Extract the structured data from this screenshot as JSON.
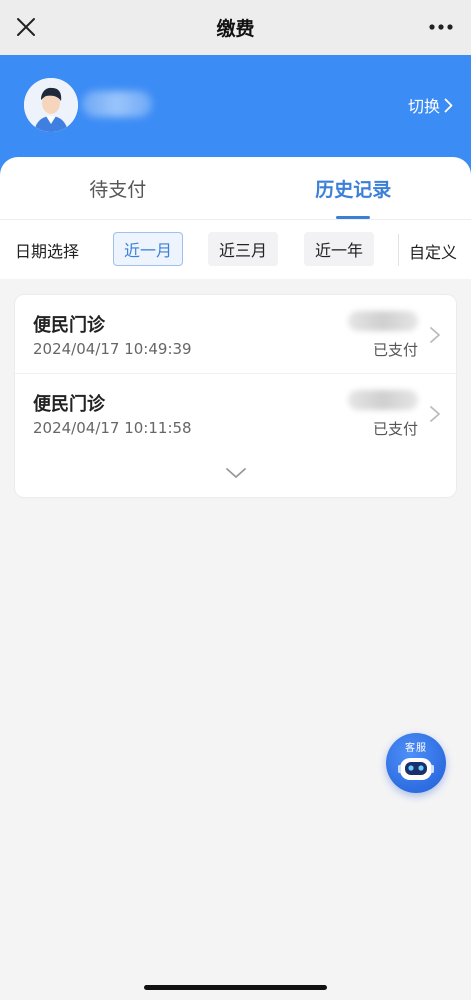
{
  "navbar": {
    "title": "缴费"
  },
  "header": {
    "switch_label": "切换"
  },
  "tabs": [
    {
      "label": "待支付",
      "active": false
    },
    {
      "label": "历史记录",
      "active": true
    }
  ],
  "date_filter": {
    "label": "日期选择",
    "options": [
      "近一月",
      "近三月",
      "近一年"
    ],
    "selected": "近一月",
    "custom_label": "自定义"
  },
  "records": [
    {
      "title": "便民门诊",
      "time": "2024/04/17 10:49:39",
      "status": "已支付"
    },
    {
      "title": "便民门诊",
      "time": "2024/04/17 10:11:58",
      "status": "已支付"
    }
  ],
  "service_button": {
    "label": "客服"
  },
  "colors": {
    "accent": "#3b80d8",
    "header_bg": "#3c8cf5",
    "page_bg": "#f4f4f5"
  }
}
